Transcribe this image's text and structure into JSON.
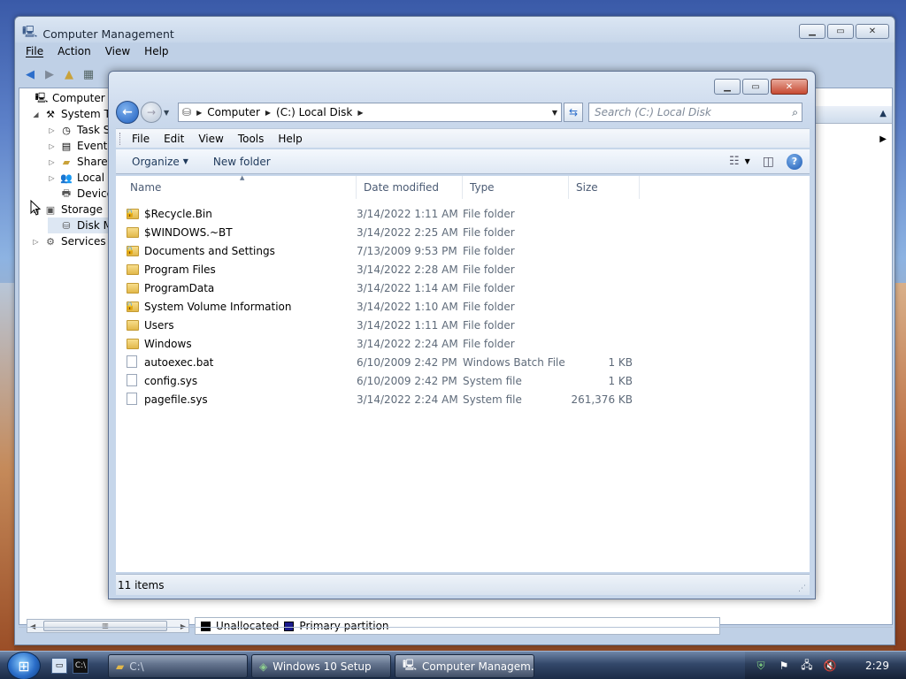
{
  "back_window": {
    "title": "Computer Management",
    "menu": [
      "File",
      "Action",
      "View",
      "Help"
    ],
    "tree": [
      {
        "label": "Computer Ma",
        "icon": "computer-icon",
        "level": 0,
        "twisty": ""
      },
      {
        "label": "System To",
        "icon": "tools-icon",
        "level": 1,
        "twisty": "◢"
      },
      {
        "label": "Task Sc",
        "icon": "clock-icon",
        "level": 2,
        "twisty": "▷"
      },
      {
        "label": "Event V",
        "icon": "event-viewer-icon",
        "level": 2,
        "twisty": "▷"
      },
      {
        "label": "Shared",
        "icon": "shared-folder-icon",
        "level": 2,
        "twisty": "▷"
      },
      {
        "label": "Local U",
        "icon": "users-icon",
        "level": 2,
        "twisty": "▷"
      },
      {
        "label": "Device",
        "icon": "device-manager-icon",
        "level": 2,
        "twisty": ""
      },
      {
        "label": "Storage",
        "icon": "storage-icon",
        "level": 1,
        "twisty": "◢"
      },
      {
        "label": "Disk M",
        "icon": "disk-icon",
        "level": 2,
        "twisty": ""
      },
      {
        "label": "Services ar",
        "icon": "services-icon",
        "level": 1,
        "twisty": "▷"
      }
    ],
    "legend": [
      {
        "label": "Unallocated",
        "color": "#000000"
      },
      {
        "label": "Primary partition",
        "color": "#1a1a8c"
      }
    ]
  },
  "explorer": {
    "breadcrumb": [
      "Computer",
      "(C:) Local Disk"
    ],
    "search_placeholder": "Search (C:) Local Disk",
    "menu": [
      "File",
      "Edit",
      "View",
      "Tools",
      "Help"
    ],
    "commands": {
      "organize": "Organize",
      "new_folder": "New folder"
    },
    "columns": {
      "name": "Name",
      "date": "Date modified",
      "type": "Type",
      "size": "Size"
    },
    "files": [
      {
        "name": "$Recycle.Bin",
        "date": "3/14/2022 1:11 AM",
        "type": "File folder",
        "size": "",
        "kind": "folder",
        "locked": true
      },
      {
        "name": "$WINDOWS.~BT",
        "date": "3/14/2022 2:25 AM",
        "type": "File folder",
        "size": "",
        "kind": "folder",
        "locked": false
      },
      {
        "name": "Documents and Settings",
        "date": "7/13/2009 9:53 PM",
        "type": "File folder",
        "size": "",
        "kind": "folder",
        "locked": true
      },
      {
        "name": "Program Files",
        "date": "3/14/2022 2:28 AM",
        "type": "File folder",
        "size": "",
        "kind": "folder",
        "locked": false
      },
      {
        "name": "ProgramData",
        "date": "3/14/2022 1:14 AM",
        "type": "File folder",
        "size": "",
        "kind": "folder",
        "locked": false
      },
      {
        "name": "System Volume Information",
        "date": "3/14/2022 1:10 AM",
        "type": "File folder",
        "size": "",
        "kind": "folder",
        "locked": true
      },
      {
        "name": "Users",
        "date": "3/14/2022 1:11 AM",
        "type": "File folder",
        "size": "",
        "kind": "folder",
        "locked": false
      },
      {
        "name": "Windows",
        "date": "3/14/2022 2:24 AM",
        "type": "File folder",
        "size": "",
        "kind": "folder",
        "locked": false
      },
      {
        "name": "autoexec.bat",
        "date": "6/10/2009 2:42 PM",
        "type": "Windows Batch File",
        "size": "1 KB",
        "kind": "batch",
        "locked": false
      },
      {
        "name": "config.sys",
        "date": "6/10/2009 2:42 PM",
        "type": "System file",
        "size": "1 KB",
        "kind": "file",
        "locked": false
      },
      {
        "name": "pagefile.sys",
        "date": "3/14/2022 2:24 AM",
        "type": "System file",
        "size": "261,376 KB",
        "kind": "file",
        "locked": false
      }
    ],
    "status": "11 items"
  },
  "taskbar": {
    "buttons": [
      {
        "label": "C:\\",
        "icon": "folder-icon",
        "active": false
      },
      {
        "label": "Windows 10 Setup",
        "icon": "setup-icon",
        "active": false
      },
      {
        "label": "Computer Managem...",
        "icon": "computer-management-icon",
        "active": true
      }
    ],
    "clock": "2:29"
  },
  "colors": {
    "accent": "#2c6ecb",
    "folder": "#e2b84a",
    "taskbar": "#33486a"
  }
}
